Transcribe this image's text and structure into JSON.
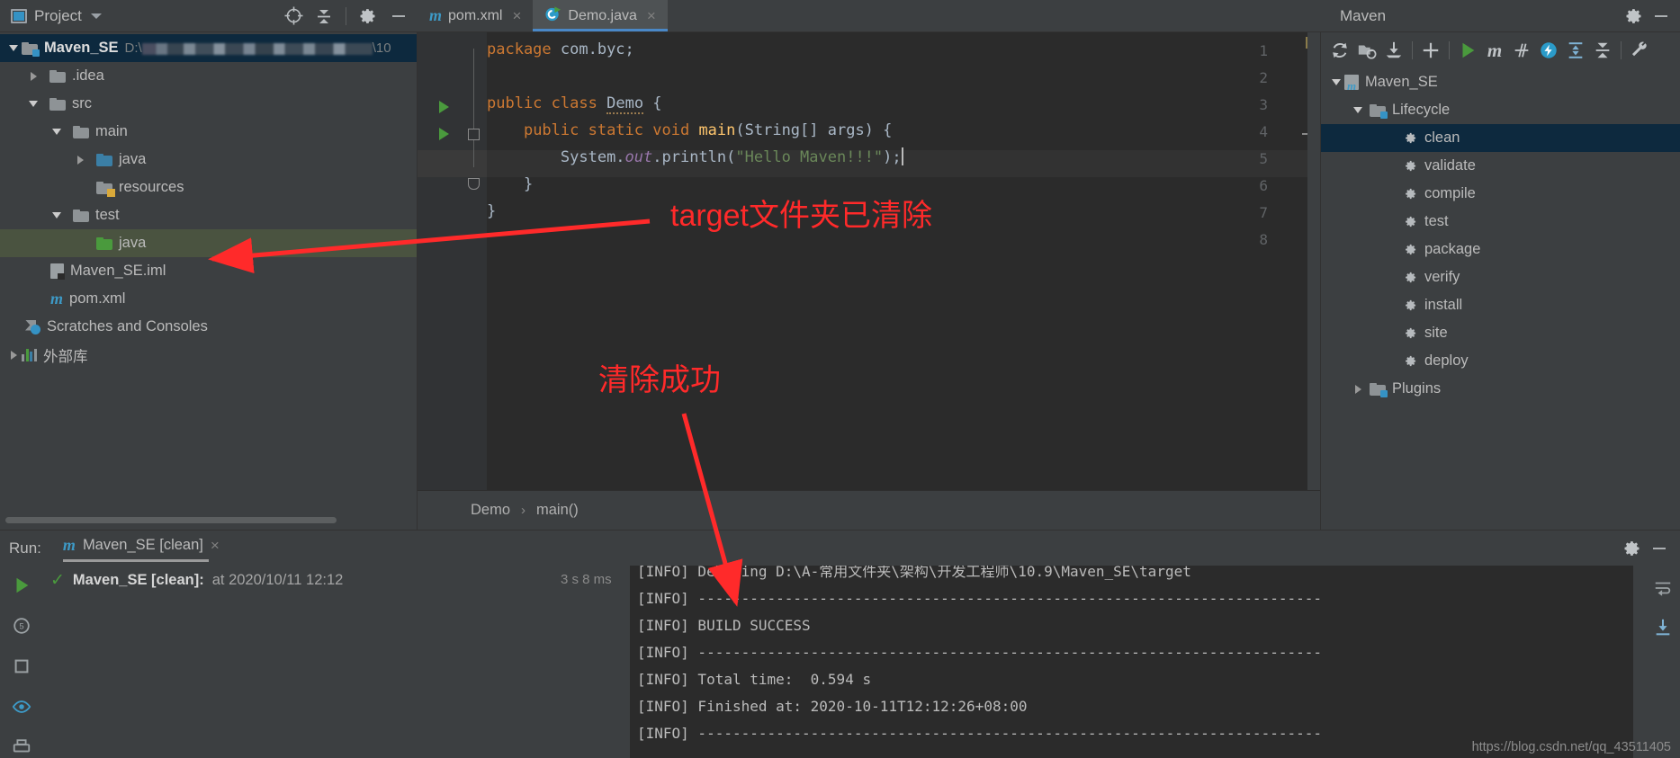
{
  "project_panel": {
    "title": "Project",
    "icons": [
      "project-view-icon",
      "locate-icon",
      "collapse-all-icon",
      "settings-icon",
      "hide-icon"
    ],
    "tree": [
      {
        "label": "Maven_SE",
        "path": "D:\\",
        "path_blurred": true,
        "path_tail": "\\10",
        "depth": 0,
        "arrow": "down",
        "icon": "module-folder-icon",
        "selected": "blue",
        "bold": true
      },
      {
        "label": ".idea",
        "depth": 1,
        "arrow": "right",
        "icon": "folder-icon"
      },
      {
        "label": "src",
        "depth": 1,
        "arrow": "down",
        "icon": "folder-icon"
      },
      {
        "label": "main",
        "depth": 2,
        "arrow": "down",
        "icon": "folder-icon"
      },
      {
        "label": "java",
        "depth": 3,
        "arrow": "right",
        "icon": "source-folder-icon-blue"
      },
      {
        "label": "resources",
        "depth": 3,
        "arrow": "none",
        "icon": "resources-folder-icon"
      },
      {
        "label": "test",
        "depth": 2,
        "arrow": "down",
        "icon": "folder-icon"
      },
      {
        "label": "java",
        "depth": 3,
        "arrow": "none",
        "icon": "test-source-folder-icon-green",
        "selected": "green"
      },
      {
        "label": "Maven_SE.iml",
        "depth": 2,
        "arrow": "none",
        "icon": "iml-file-icon"
      },
      {
        "label": "pom.xml",
        "depth": 2,
        "arrow": "none",
        "icon": "maven-pom-icon"
      },
      {
        "label": "Scratches and Consoles",
        "depth": 1,
        "arrow": "none",
        "icon": "scratches-icon"
      },
      {
        "label": "外部库",
        "depth": 0,
        "arrow": "right",
        "icon": "external-libraries-icon"
      }
    ]
  },
  "editor_tabs": [
    {
      "label": "pom.xml",
      "icon": "maven-pom-icon",
      "active": false,
      "close": "×"
    },
    {
      "label": "Demo.java",
      "icon": "java-class-run-icon",
      "active": true,
      "close": "×"
    }
  ],
  "editor": {
    "lines": [
      {
        "n": "1",
        "run": false
      },
      {
        "n": "2",
        "run": false
      },
      {
        "n": "3",
        "run": true
      },
      {
        "n": "4",
        "run": true
      },
      {
        "n": "5",
        "run": false
      },
      {
        "n": "6",
        "run": false
      },
      {
        "n": "7",
        "run": false
      },
      {
        "n": "8",
        "run": false
      }
    ],
    "code": {
      "l1_kw": "package",
      "l1_rest": " com.byc;",
      "l3_kw1": "public",
      "l3_kw2": "class",
      "l3_name": "Demo",
      "l3_brace": " {",
      "l4_kw": "public static void",
      "l4_name": "main",
      "l4_args": "(String[] args) {",
      "l5_a": "System.",
      "l5_out": "out",
      "l5_b": ".println(",
      "l5_str": "\"Hello Maven!!!\"",
      "l5_c": ");",
      "l6": "}",
      "l7": "}"
    }
  },
  "breadcrumb": {
    "items": [
      "Demo",
      "main()"
    ],
    "separator": "›"
  },
  "maven_panel": {
    "title": "Maven",
    "toolbar": [
      "reload-icon",
      "add-managed-files-icon",
      "download-sources-icon",
      "add-maven-project-icon",
      "run-icon",
      "execute-maven-goal-icon",
      "toggle-skip-tests-icon",
      "toggle-offline-mode-icon",
      "expand-all-icon",
      "collapse-all-icon",
      "maven-settings-icon"
    ],
    "header_icons": [
      "settings-icon",
      "hide-icon"
    ],
    "tree": [
      {
        "label": "Maven_SE",
        "depth": 0,
        "arrow": "down",
        "icon": "maven-project-icon"
      },
      {
        "label": "Lifecycle",
        "depth": 1,
        "arrow": "down",
        "icon": "lifecycle-folder-icon"
      },
      {
        "label": "clean",
        "depth": 2,
        "arrow": "none",
        "icon": "maven-goal-icon",
        "selected": true
      },
      {
        "label": "validate",
        "depth": 2,
        "arrow": "none",
        "icon": "maven-goal-icon"
      },
      {
        "label": "compile",
        "depth": 2,
        "arrow": "none",
        "icon": "maven-goal-icon"
      },
      {
        "label": "test",
        "depth": 2,
        "arrow": "none",
        "icon": "maven-goal-icon"
      },
      {
        "label": "package",
        "depth": 2,
        "arrow": "none",
        "icon": "maven-goal-icon"
      },
      {
        "label": "verify",
        "depth": 2,
        "arrow": "none",
        "icon": "maven-goal-icon"
      },
      {
        "label": "install",
        "depth": 2,
        "arrow": "none",
        "icon": "maven-goal-icon"
      },
      {
        "label": "site",
        "depth": 2,
        "arrow": "none",
        "icon": "maven-goal-icon"
      },
      {
        "label": "deploy",
        "depth": 2,
        "arrow": "none",
        "icon": "maven-goal-icon"
      },
      {
        "label": "Plugins",
        "depth": 1,
        "arrow": "right",
        "icon": "plugins-folder-icon"
      }
    ]
  },
  "run_panel": {
    "label": "Run:",
    "tab": {
      "label": "Maven_SE [clean]",
      "icon": "maven-pom-icon",
      "close": "×"
    },
    "header_icons": [
      "settings-icon",
      "hide-icon"
    ],
    "sidebar_icons": [
      "run-icon",
      "rerun-failed-icon",
      "stop-icon",
      "toggle-auto-test-icon",
      "print-icon"
    ],
    "right_icons": [
      "soft-wrap-icon",
      "scroll-to-end-icon"
    ],
    "tree_row": {
      "status": "✓",
      "name": "Maven_SE [clean]:",
      "at": "at 2020/10/11 12:12"
    },
    "duration": "3 s 8 ms",
    "console": [
      "[INFO] Deleting D:\\A-常用文件夹\\架构\\开发工程师\\10.9\\Maven_SE\\target",
      "[INFO] ------------------------------------------------------------------------",
      "[INFO] BUILD SUCCESS",
      "[INFO] ------------------------------------------------------------------------",
      "[INFO] Total time:  0.594 s",
      "[INFO] Finished at: 2020-10-11T12:12:26+08:00",
      "[INFO] ------------------------------------------------------------------------"
    ]
  },
  "annotations": [
    {
      "text": "target文件夹已清除",
      "color": "#ff2a2a"
    },
    {
      "text": "清除成功",
      "color": "#ff2a2a"
    }
  ],
  "watermark": "https://blog.csdn.net/qq_43511405"
}
